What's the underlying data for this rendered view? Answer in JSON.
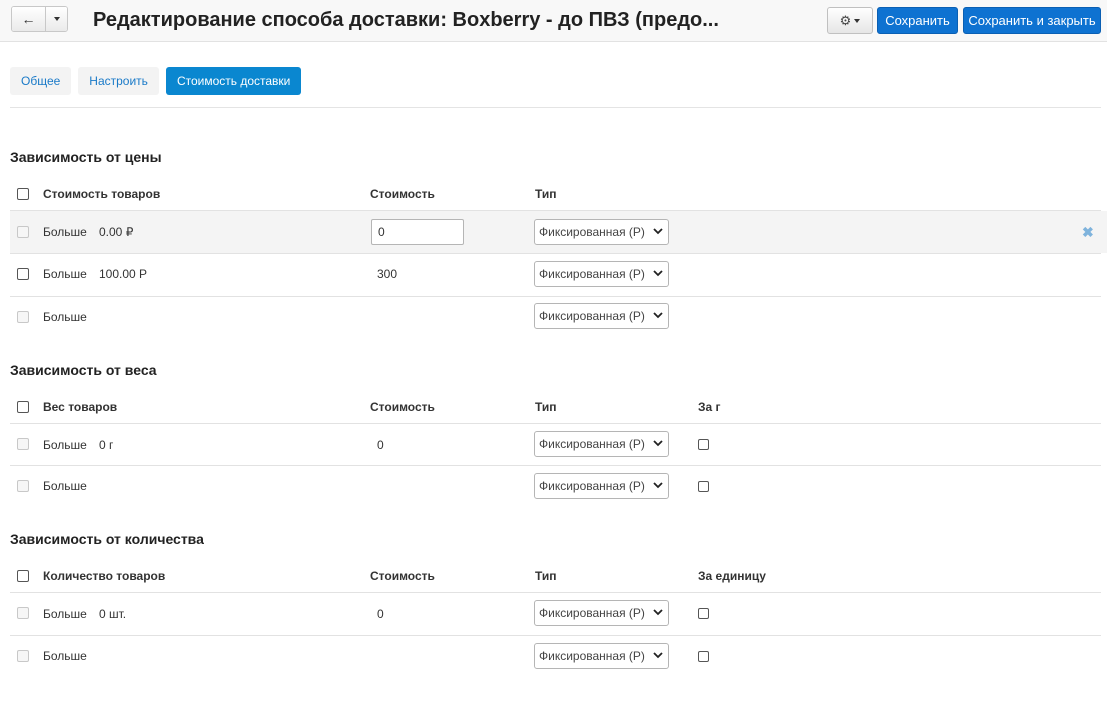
{
  "header": {
    "back_icon": "←",
    "title": "Редактирование способа доставки: Boxberry - до ПВЗ (предо...",
    "settings_icon": "⚙",
    "save_label": "Сохранить",
    "save_close_label": "Сохранить и закрыть"
  },
  "tabs": [
    {
      "label": "Общее"
    },
    {
      "label": "Настроить"
    },
    {
      "label": "Стоимость доставки",
      "active": true
    }
  ],
  "price": {
    "title": "Зависимость от цены",
    "headers": {
      "goods": "Стоимость товаров",
      "cost": "Стоимость",
      "type": "Тип"
    },
    "rows": [
      {
        "more": "Больше",
        "value": "0.00 ₽",
        "cost": "0",
        "type": "Фиксированная (Р)",
        "remove": "✖"
      },
      {
        "more": "Больше",
        "value": "100.00 Р",
        "cost": "300",
        "type": "Фиксированная (Р)"
      },
      {
        "more": "Больше",
        "type": "Фиксированная (Р)"
      }
    ]
  },
  "weight": {
    "title": "Зависимость от веса",
    "headers": {
      "goods": "Вес товаров",
      "cost": "Стоимость",
      "type": "Тип",
      "per": "За г"
    },
    "rows": [
      {
        "more": "Больше",
        "value": "0 г",
        "cost": "0",
        "type": "Фиксированная (Р)"
      },
      {
        "more": "Больше",
        "type": "Фиксированная (Р)"
      }
    ]
  },
  "quantity": {
    "title": "Зависимость от количества",
    "headers": {
      "goods": "Количество товаров",
      "cost": "Стоимость",
      "type": "Тип",
      "per": "За единицу"
    },
    "rows": [
      {
        "more": "Больше",
        "value": "0 шт.",
        "cost": "0",
        "type": "Фиксированная (Р)"
      },
      {
        "more": "Больше",
        "type": "Фиксированная (Р)"
      }
    ]
  }
}
